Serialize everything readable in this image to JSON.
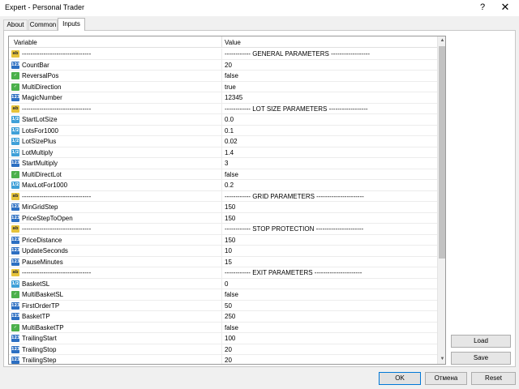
{
  "window": {
    "title": "Expert - Personal Trader",
    "help_glyph": "?",
    "close_glyph": "✕"
  },
  "tabs": [
    {
      "label": "About"
    },
    {
      "label": "Common"
    },
    {
      "label": "Inputs",
      "active": true
    }
  ],
  "grid": {
    "header": {
      "variable": "Variable",
      "value": "Value"
    },
    "rows": [
      {
        "type": "string",
        "variable": "--------------------------------",
        "value": "------------ GENERAL PARAMETERS ------------------"
      },
      {
        "type": "int",
        "variable": "CountBar",
        "value": "20"
      },
      {
        "type": "bool",
        "variable": "ReversalPos",
        "value": "false"
      },
      {
        "type": "bool",
        "variable": "MultiDirection",
        "value": "true"
      },
      {
        "type": "int",
        "variable": "MagicNumber",
        "value": "12345"
      },
      {
        "type": "string",
        "variable": "--------------------------------",
        "value": "------------ LOT SIZE PARAMETERS ------------------"
      },
      {
        "type": "double",
        "variable": "StartLotSize",
        "value": "0.0"
      },
      {
        "type": "double",
        "variable": "LotsFor1000",
        "value": "0.1"
      },
      {
        "type": "double",
        "variable": "LotSizePlus",
        "value": "0.02"
      },
      {
        "type": "double",
        "variable": "LotMultiply",
        "value": "1.4"
      },
      {
        "type": "int",
        "variable": "StartMultiply",
        "value": "3"
      },
      {
        "type": "bool",
        "variable": "MultiDirectLot",
        "value": "false"
      },
      {
        "type": "double",
        "variable": "MaxLotFor1000",
        "value": "0.2"
      },
      {
        "type": "string",
        "variable": "--------------------------------",
        "value": "------------ GRID PARAMETERS ----------------------"
      },
      {
        "type": "int",
        "variable": "MinGridStep",
        "value": "150"
      },
      {
        "type": "int",
        "variable": "PriceStepToOpen",
        "value": "150"
      },
      {
        "type": "string",
        "variable": "--------------------------------",
        "value": "------------ STOP PROTECTION ----------------------"
      },
      {
        "type": "int",
        "variable": "PriceDistance",
        "value": "150"
      },
      {
        "type": "int",
        "variable": "UpdateSeconds",
        "value": "10"
      },
      {
        "type": "int",
        "variable": "PauseMinutes",
        "value": "15"
      },
      {
        "type": "string",
        "variable": "--------------------------------",
        "value": "------------ EXIT PARAMETERS ----------------------"
      },
      {
        "type": "double",
        "variable": "BasketSL",
        "value": "0"
      },
      {
        "type": "bool",
        "variable": "MultiBasketSL",
        "value": "false"
      },
      {
        "type": "int",
        "variable": "FirstOrderTP",
        "value": "50"
      },
      {
        "type": "int",
        "variable": "BasketTP",
        "value": "250"
      },
      {
        "type": "bool",
        "variable": "MultiBasketTP",
        "value": "false"
      },
      {
        "type": "int",
        "variable": "TrailingStart",
        "value": "100"
      },
      {
        "type": "int",
        "variable": "TrailingStop",
        "value": "20"
      },
      {
        "type": "int",
        "variable": "TrailingStep",
        "value": "20"
      }
    ],
    "icon_glyphs": {
      "int": "123",
      "double": "1/2",
      "bool": "✓",
      "string": "ab"
    },
    "scroll_up_glyph": "▲",
    "scroll_down_glyph": "▼"
  },
  "buttons": {
    "load": "Load",
    "save": "Save",
    "ok": "OK",
    "cancel": "Отмена",
    "reset": "Reset"
  },
  "colors": {
    "accent": "#0078d7",
    "icon_int": "#2c6fc2",
    "icon_double": "#3fa0d8",
    "icon_bool": "#4bb04b",
    "icon_string": "#e6c33a"
  }
}
